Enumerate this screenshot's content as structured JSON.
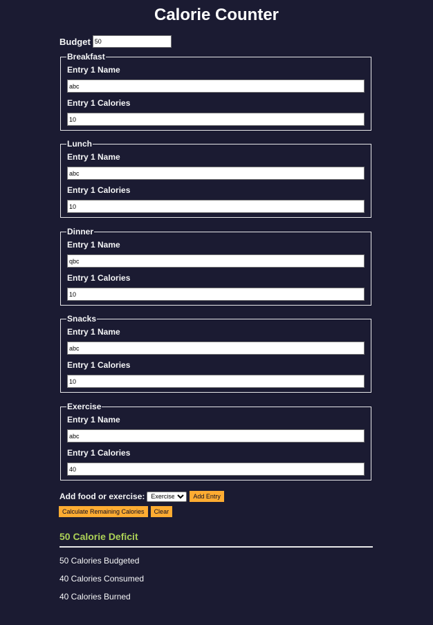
{
  "title": "Calorie Counter",
  "budget": {
    "label": "Budget",
    "value": "50"
  },
  "sections": [
    {
      "legend": "Breakfast",
      "name_label": "Entry 1 Name",
      "name_value": "abc",
      "cal_label": "Entry 1 Calories",
      "cal_value": "10"
    },
    {
      "legend": "Lunch",
      "name_label": "Entry 1 Name",
      "name_value": "abc",
      "cal_label": "Entry 1 Calories",
      "cal_value": "10"
    },
    {
      "legend": "Dinner",
      "name_label": "Entry 1 Name",
      "name_value": "qbc",
      "cal_label": "Entry 1 Calories",
      "cal_value": "10"
    },
    {
      "legend": "Snacks",
      "name_label": "Entry 1 Name",
      "name_value": "abc",
      "cal_label": "Entry 1 Calories",
      "cal_value": "10"
    },
    {
      "legend": "Exercise",
      "name_label": "Entry 1 Name",
      "name_value": "abc",
      "cal_label": "Entry 1 Calories",
      "cal_value": "40"
    }
  ],
  "add": {
    "label": "Add food or exercise:",
    "selected": "Exercise",
    "add_button": "Add Entry"
  },
  "actions": {
    "calculate": "Calculate Remaining Calories",
    "clear": "Clear"
  },
  "output": {
    "deficit": "50 Calorie Deficit",
    "budgeted": "50 Calories Budgeted",
    "consumed": "40 Calories Consumed",
    "burned": "40 Calories Burned"
  },
  "colors": {
    "background": "#1b1b32",
    "accent": "#feac32",
    "deficit": "#acd157"
  }
}
